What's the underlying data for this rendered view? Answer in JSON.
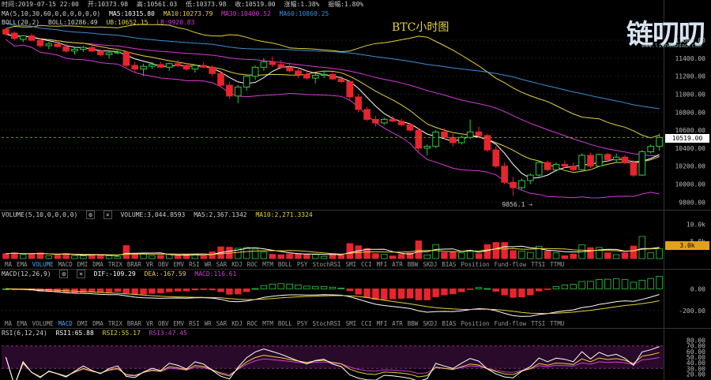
{
  "header": {
    "time": "时间:2019-07-15 22:00",
    "open": "开:10373.98",
    "high": "高:10561.03",
    "low": "低:10373.98",
    "close": "收:10519.00",
    "change": "涨幅:1.38%",
    "amplitude": "振幅:1.80%"
  },
  "ma_line": {
    "label": "MA(5,10,30,60,0,0,0,0,0,0)",
    "ma5": "MA5:10315.80",
    "ma10": "MA10:10273.79",
    "ma30": "MA30:10400.52",
    "ma60": "MA60:10860.25"
  },
  "boll_line": {
    "label": "BOLL(20,2)",
    "boll": "BOLL:10286.49",
    "ub": "UB:10652.15",
    "lb": "LB:9920.83"
  },
  "chart_title": "BTC小时图",
  "logo": {
    "text": "链叨叨",
    "url": "www.liandaodao.com"
  },
  "price_axis": [
    "11600.00",
    "11400.00",
    "11200.00",
    "11000.00",
    "10800.00",
    "10600.00",
    "10400.00",
    "10200.00",
    "10000.00",
    "9800.00"
  ],
  "current_price": "10519.00",
  "low_marker": "9856.1",
  "volume": {
    "label": "VOLUME(5,10,0,0,0,0)",
    "volume": "VOLUME:3,044.8593",
    "ma5": "MA5:2,367.1342",
    "ma10": "MA10:2,271.3324",
    "axis": [
      "10.0k",
      "5.0k"
    ],
    "current": "3.0k"
  },
  "macd": {
    "label": "MACD(12,26,9)",
    "dif": "DIF:-109.29",
    "dea": "DEA:-167.59",
    "macd": "MACD:116.61",
    "axis": [
      "0.00",
      "-200.00"
    ]
  },
  "rsi": {
    "label": "RSI(6,12,24)",
    "rsi1": "RSI1:65.88",
    "rsi2": "RSI2:55.17",
    "rsi3": "RSI3:47.45",
    "axis": [
      "80.00",
      "70.00",
      "60.00",
      "50.00",
      "40.00",
      "30.00",
      "20.00"
    ]
  },
  "indicator_tabs": [
    "MA",
    "EMA",
    "VOLUME",
    "MACD",
    "DMI",
    "DMA",
    "TRIX",
    "BRAR",
    "VR",
    "OBV",
    "EMV",
    "RSI",
    "WR",
    "SAR",
    "KDJ",
    "ROC",
    "MTM",
    "BOLL",
    "PSY",
    "StochRSI",
    "SMI",
    "CCI",
    "MFI",
    "ATR",
    "BBW",
    "SKDJ",
    "BIAS",
    "Position",
    "Fund-flow",
    "TTSI",
    "TTMU"
  ],
  "tabs_row1_active": "VOLUME",
  "tabs_row2_active": "MACD",
  "colors": {
    "up": "#2ecc40",
    "down": "#e8242d",
    "ma5": "#ffffff",
    "ma10": "#e6d23a",
    "ma30": "#d63ad6",
    "ma60": "#3a8fd6",
    "boll": "#c8c8c8"
  },
  "chart_data": {
    "type": "candlestick",
    "title": "BTC小时图",
    "ylim": [
      9750,
      11750
    ],
    "candles": [
      [
        11720,
        11740,
        11650,
        11670
      ],
      [
        11680,
        11700,
        11600,
        11620
      ],
      [
        11610,
        11660,
        11580,
        11650
      ],
      [
        11650,
        11680,
        11590,
        11600
      ],
      [
        11600,
        11620,
        11520,
        11540
      ],
      [
        11540,
        11580,
        11500,
        11560
      ],
      [
        11560,
        11600,
        11520,
        11530
      ],
      [
        11530,
        11560,
        11460,
        11480
      ],
      [
        11480,
        11520,
        11440,
        11500
      ],
      [
        11500,
        11540,
        11470,
        11520
      ],
      [
        11520,
        11550,
        11470,
        11480
      ],
      [
        11480,
        11500,
        11420,
        11440
      ],
      [
        11440,
        11480,
        11400,
        11460
      ],
      [
        11460,
        11500,
        11440,
        11470
      ],
      [
        11470,
        11480,
        11300,
        11320
      ],
      [
        11320,
        11360,
        11240,
        11280
      ],
      [
        11280,
        11340,
        11200,
        11310
      ],
      [
        11310,
        11360,
        11280,
        11330
      ],
      [
        11330,
        11360,
        11290,
        11300
      ],
      [
        11300,
        11350,
        11260,
        11340
      ],
      [
        11340,
        11380,
        11300,
        11320
      ],
      [
        11320,
        11350,
        11260,
        11280
      ],
      [
        11280,
        11330,
        11240,
        11320
      ],
      [
        11320,
        11360,
        11290,
        11300
      ],
      [
        11300,
        11320,
        11200,
        11230
      ],
      [
        11230,
        11260,
        11080,
        11100
      ],
      [
        11100,
        11140,
        10950,
        10980
      ],
      [
        10980,
        11100,
        10900,
        11080
      ],
      [
        11080,
        11220,
        11040,
        11200
      ],
      [
        11200,
        11320,
        11160,
        11300
      ],
      [
        11300,
        11400,
        11260,
        11360
      ],
      [
        11360,
        11420,
        11300,
        11330
      ],
      [
        11330,
        11380,
        11280,
        11300
      ],
      [
        11300,
        11350,
        11240,
        11260
      ],
      [
        11260,
        11300,
        11180,
        11220
      ],
      [
        11220,
        11260,
        11160,
        11180
      ],
      [
        11180,
        11230,
        11120,
        11210
      ],
      [
        11210,
        11260,
        11180,
        11220
      ],
      [
        11220,
        11250,
        11160,
        11170
      ],
      [
        11170,
        11200,
        11120,
        11140
      ],
      [
        11140,
        11160,
        10940,
        10970
      ],
      [
        10970,
        11000,
        10800,
        10830
      ],
      [
        10830,
        10860,
        10700,
        10720
      ],
      [
        10720,
        10760,
        10640,
        10680
      ],
      [
        10680,
        10740,
        10660,
        10720
      ],
      [
        10720,
        10760,
        10690,
        10700
      ],
      [
        10700,
        10730,
        10640,
        10660
      ],
      [
        10660,
        10680,
        10580,
        10600
      ],
      [
        10600,
        10620,
        10360,
        10400
      ],
      [
        10400,
        10440,
        10320,
        10420
      ],
      [
        10420,
        10600,
        10400,
        10580
      ],
      [
        10580,
        10620,
        10500,
        10520
      ],
      [
        10520,
        10560,
        10420,
        10460
      ],
      [
        10460,
        10540,
        10440,
        10520
      ],
      [
        10520,
        10720,
        10500,
        10580
      ],
      [
        10580,
        10640,
        10520,
        10540
      ],
      [
        10540,
        10560,
        10360,
        10380
      ],
      [
        10380,
        10420,
        10180,
        10200
      ],
      [
        10200,
        10240,
        10000,
        10020
      ],
      [
        10020,
        10080,
        9870,
        9960
      ],
      [
        9960,
        10060,
        9940,
        10040
      ],
      [
        10040,
        10120,
        10000,
        10100
      ],
      [
        10100,
        10260,
        10080,
        10240
      ],
      [
        10240,
        10260,
        10140,
        10160
      ],
      [
        10160,
        10240,
        10140,
        10220
      ],
      [
        10220,
        10260,
        10180,
        10200
      ],
      [
        10200,
        10240,
        10140,
        10160
      ],
      [
        10160,
        10340,
        10150,
        10320
      ],
      [
        10320,
        10350,
        10180,
        10200
      ],
      [
        10200,
        10340,
        10190,
        10330
      ],
      [
        10330,
        10350,
        10250,
        10270
      ],
      [
        10270,
        10340,
        10240,
        10300
      ],
      [
        10300,
        10320,
        10220,
        10240
      ],
      [
        10240,
        10270,
        10080,
        10100
      ],
      [
        10100,
        10380,
        10090,
        10360
      ],
      [
        10360,
        10440,
        10340,
        10420
      ],
      [
        10420,
        10561,
        10373,
        10519
      ]
    ]
  }
}
